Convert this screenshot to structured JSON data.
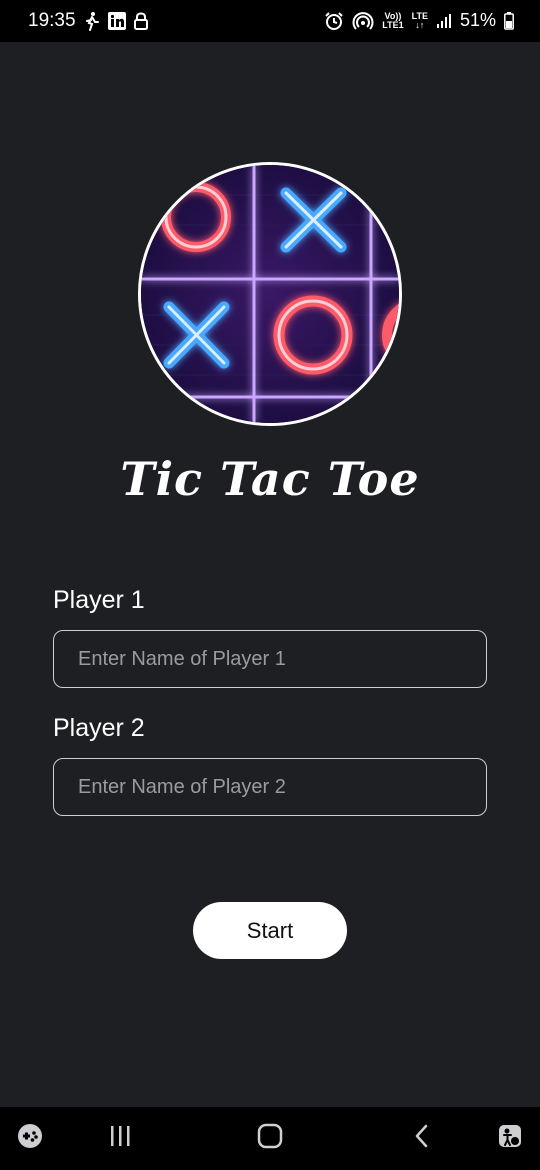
{
  "status_bar": {
    "time": "19:35",
    "battery_percent": "51%",
    "network_label": "LTE",
    "volte_label": "Vo))",
    "lte1_label": "LTE1"
  },
  "app": {
    "title": "Tic Tac Toe",
    "logo_icon": "tic-tac-toe-neon-logo"
  },
  "form": {
    "player1": {
      "label": "Player 1",
      "placeholder": "Enter Name of Player 1",
      "value": ""
    },
    "player2": {
      "label": "Player 2",
      "placeholder": "Enter Name of Player 2",
      "value": ""
    },
    "start_label": "Start"
  },
  "nav_bar": {
    "items": [
      "game-launcher-icon",
      "recents-icon",
      "home-icon",
      "back-icon",
      "accessibility-icon"
    ]
  },
  "colors": {
    "background": "#1e1f23",
    "status_bar": "#000000",
    "button": "#ffffff",
    "neon_blue": "#4aa8ff",
    "neon_red": "#ff4a5a",
    "grid_purple": "#b58cff"
  }
}
